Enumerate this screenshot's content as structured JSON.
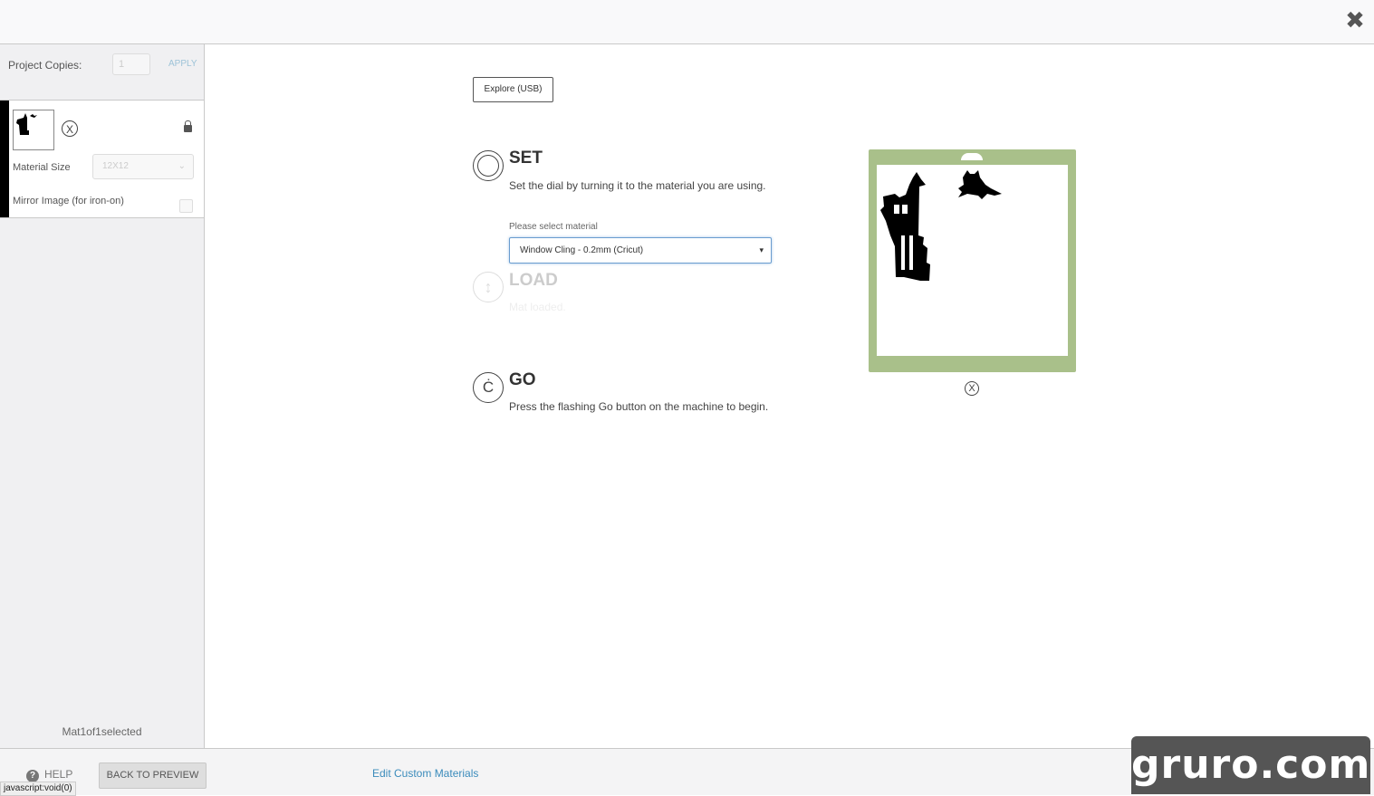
{
  "sidebar": {
    "project_copies_label": "Project Copies:",
    "project_copies_value": "1",
    "apply_label": "APPLY",
    "material_size_label": "Material Size",
    "material_size_value": "12X12",
    "mirror_label": "Mirror Image (for iron-on)",
    "mat_status": "Mat1of1selected",
    "machine_icon_glyph": "X"
  },
  "main": {
    "machine_button": "Explore (USB)",
    "steps": [
      {
        "title": "SET",
        "description": "Set the dial by turning it to the material you are using."
      },
      {
        "title": "LOAD",
        "description": "Mat loaded."
      },
      {
        "title": "GO",
        "description": "Press the flashing Go button on the machine to begin."
      }
    ],
    "material_select_label": "Please select material",
    "material_select_value": "Window Cling - 0.2mm (Cricut)",
    "preview_machine_glyph": "X"
  },
  "bottom": {
    "help_label": "HELP",
    "back_label": "BACK TO PREVIEW",
    "edit_label": "Edit Custom Materials"
  },
  "status_bar": "javascript:void(0)",
  "watermark": "gruro.com",
  "colors": {
    "mat_green": "#a9c08a",
    "link_blue": "#3a8bbb",
    "select_border": "#6a9ccf"
  }
}
